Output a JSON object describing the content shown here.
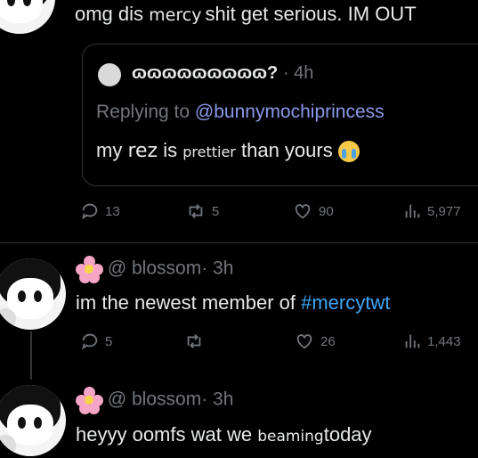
{
  "top_tweet": {
    "text_a": "omg dis ",
    "text_mercy": "mercy",
    "text_b": "shit get serious. IM OUT"
  },
  "quoted": {
    "name": "ɷɷɷɷɷɷɷɷɷ?",
    "dot": "·",
    "time": "4h",
    "replying_label": "Replying to ",
    "replying_handle": "@bunnymochiprincess",
    "body_a": "my ",
    "body_rez": "rez",
    "body_b": " is ",
    "body_prettier": "prettier",
    "body_c": " than yours"
  },
  "top_actions": {
    "replies": "13",
    "reposts": "5",
    "likes": "90",
    "views": "5,977"
  },
  "reply1": {
    "handle": "@ blossom",
    "dot": "·",
    "time": "3h",
    "text_a": "im the newest member of ",
    "hashtag": "#mercytwt",
    "actions": {
      "replies": "5",
      "reposts": "",
      "likes": "26",
      "views": "1,443"
    }
  },
  "reply2": {
    "handle": "@ blossom",
    "dot": "·",
    "time": "3h",
    "text_a": "heyyy oomfs wat we ",
    "text_beaming": "beaming",
    "text_b": "today"
  },
  "colors": {
    "background": "#000000",
    "accent": "#1d9bf0",
    "muted": "#71767b",
    "text": "#e7e9ea"
  },
  "icons": [
    "reply-icon",
    "repost-icon",
    "like-icon",
    "views-icon",
    "flower-emoji-icon",
    "crying-emoji-icon"
  ]
}
